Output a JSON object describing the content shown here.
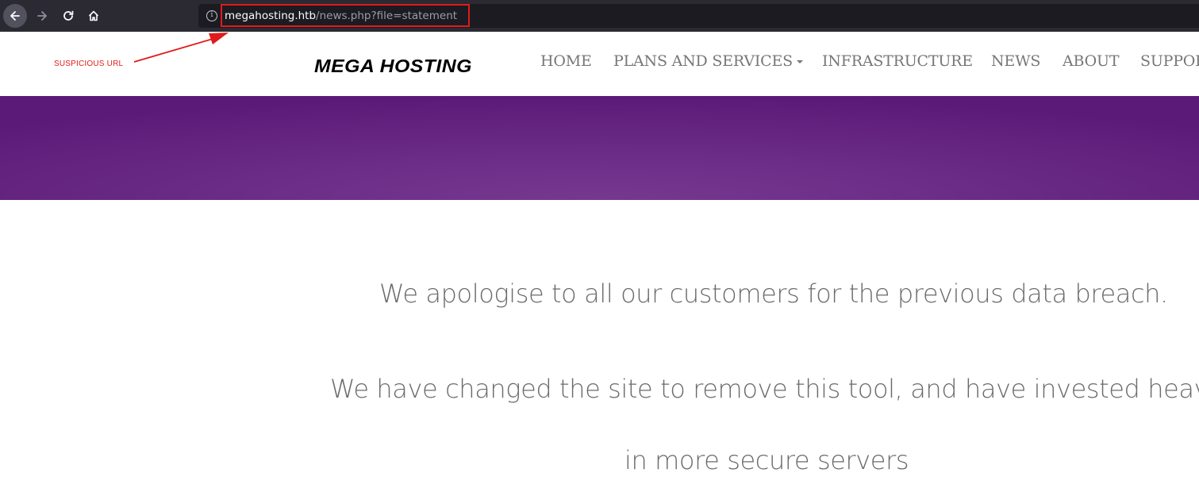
{
  "browser": {
    "url_host": "megahosting.htb",
    "url_path": "/news.php?file=statement",
    "buttons": {
      "back": "arrow-left-icon",
      "forward": "arrow-right-icon",
      "reload": "reload-icon",
      "home": "home-icon",
      "site_info": "info-icon"
    }
  },
  "annotation": {
    "label": "SUSPICIOUS URL",
    "color": "#e01b1b"
  },
  "site": {
    "logo": "MEGA HOSTING",
    "nav": [
      {
        "label": "HOME"
      },
      {
        "label": "PLANS AND SERVICES",
        "has_dropdown": true
      },
      {
        "label": "INFRASTRUCTURE"
      },
      {
        "label": "NEWS"
      },
      {
        "label": "ABOUT"
      },
      {
        "label": "SUPPORT"
      }
    ],
    "banner_color": "#5c1a78"
  },
  "content": {
    "paragraphs": [
      "We apologise to all our customers for the previous data breach.",
      "We have changed the site to remove this tool, and have invested heavily",
      "in more secure servers"
    ]
  }
}
